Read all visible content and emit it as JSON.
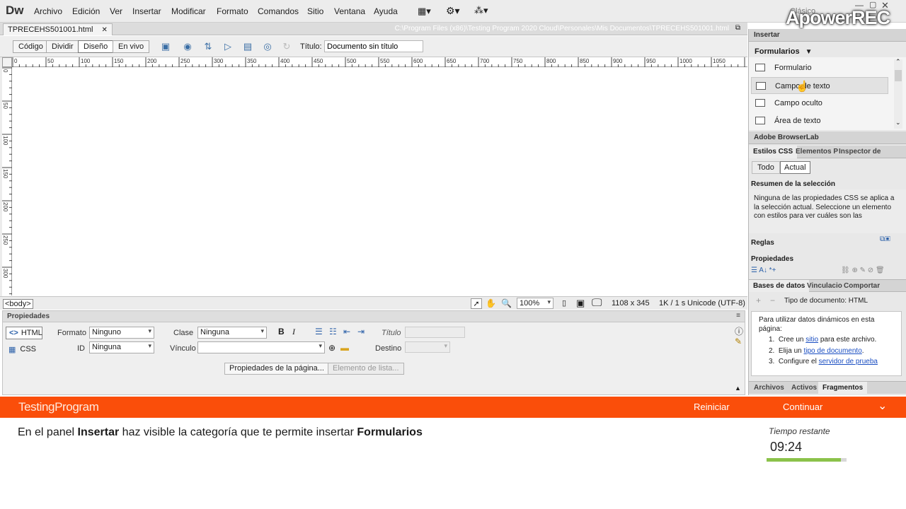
{
  "app": {
    "logo": "Dw",
    "menus": [
      "Archivo",
      "Edición",
      "Ver",
      "Insertar",
      "Modificar",
      "Formato",
      "Comandos",
      "Sitio",
      "Ventana",
      "Ayuda"
    ],
    "workspace": "Clásico",
    "watermark": "ApowerREC"
  },
  "document": {
    "tab": "TPRECEHS501001.html",
    "path": "C:\\Program Files (x86)\\Testing Program 2020 Cloud\\Personales\\Mis Documentos\\TPRECEHS501001.html",
    "view_buttons": [
      "Código",
      "Dividir",
      "Diseño",
      "En vivo"
    ],
    "title_label": "Título:",
    "title_value": "Documento sin título"
  },
  "rulers": {
    "h_labels": [
      "0",
      "50",
      "100",
      "150",
      "200",
      "250",
      "300",
      "350",
      "400",
      "450",
      "500",
      "550",
      "600",
      "650",
      "700",
      "750",
      "800",
      "850",
      "900",
      "950",
      "1000",
      "1050"
    ],
    "v_labels": [
      "0",
      "50",
      "100",
      "150",
      "200",
      "250",
      "300"
    ]
  },
  "status": {
    "tag": "<body>",
    "zoom": "100%",
    "size": "1108 x 345",
    "weight": "1K / 1 s",
    "encoding": "Unicode (UTF-8)"
  },
  "properties": {
    "header": "Propiedades",
    "html_btn": "HTML",
    "css_btn": "CSS",
    "formato_label": "Formato",
    "formato_value": "Ninguno",
    "clase_label": "Clase",
    "clase_value": "Ninguna",
    "id_label": "ID",
    "id_value": "Ninguna",
    "vinculo_label": "Vínculo",
    "titulo_label": "Título",
    "destino_label": "Destino",
    "page_props_btn": "Propiedades de la página...",
    "list_item_btn": "Elemento de lista..."
  },
  "insert_panel": {
    "header": "Insertar",
    "category": "Formularios",
    "items": [
      "Formulario",
      "Campo de texto",
      "Campo oculto",
      "Área de texto"
    ]
  },
  "browserlab": "Adobe BrowserLab",
  "css_panel": {
    "tabs": [
      "Estilos CSS",
      "Elementos P",
      "Inspector de"
    ],
    "mode_buttons": [
      "Todo",
      "Actual"
    ],
    "summary_title": "Resumen de la selección",
    "summary_text": "Ninguna de las propiedades CSS se aplica a la selección actual.  Seleccione un elemento con estilos para ver cuáles son las",
    "rules": "Reglas",
    "properties": "Propiedades"
  },
  "db_panel": {
    "tabs": [
      "Bases de datos",
      "Vinculacio",
      "Comportar"
    ],
    "doc_type": "Tipo de documento: HTML",
    "intro": "Para utilizar datos dinámicos en esta página:",
    "steps": [
      {
        "pre": "Cree un ",
        "link": "sitio",
        "post": " para este archivo."
      },
      {
        "pre": "Elija un ",
        "link": "tipo de documento",
        "post": "."
      },
      {
        "pre": "Configure el ",
        "link": "servidor de prueba",
        "post": ""
      }
    ]
  },
  "files_tabs": [
    "Archivos",
    "Activos",
    "Fragmentos"
  ],
  "exam": {
    "brand": "TestingProgram",
    "reiniciar": "Reiniciar",
    "continuar": "Continuar",
    "instruction_parts": [
      "En el panel ",
      "Insertar",
      " haz visible la categoría que te permite insertar ",
      "Formularios"
    ],
    "time_label": "Tiempo restante",
    "time_value": "09:24",
    "time_fraction": 0.93,
    "accent": "#fa4e0a",
    "progress_color": "#8bc24a"
  }
}
